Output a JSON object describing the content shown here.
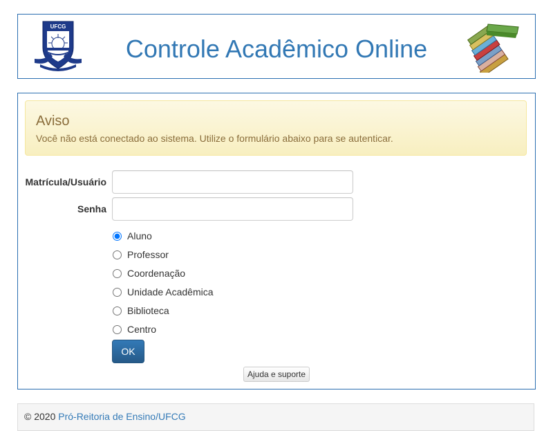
{
  "header": {
    "title": "Controle Acadêmico Online",
    "logo_text": "UFCG",
    "colors": {
      "title": "#3278b4",
      "border": "#2a6eb0"
    }
  },
  "alert": {
    "title": "Aviso",
    "text": "Você não está conectado ao sistema. Utilize o formulário abaixo para se autenticar."
  },
  "form": {
    "username_label": "Matrícula/Usuário",
    "username_value": "",
    "password_label": "Senha",
    "password_value": "",
    "roles": [
      {
        "label": "Aluno",
        "selected": true
      },
      {
        "label": "Professor",
        "selected": false
      },
      {
        "label": "Coordenação",
        "selected": false
      },
      {
        "label": "Unidade Acadêmica",
        "selected": false
      },
      {
        "label": "Biblioteca",
        "selected": false
      },
      {
        "label": "Centro",
        "selected": false
      }
    ],
    "submit_label": "OK",
    "help_label": "Ajuda e suporte"
  },
  "footer": {
    "prefix": "© 2020",
    "link_text": "Pró-Reitoria de Ensino/UFCG"
  }
}
